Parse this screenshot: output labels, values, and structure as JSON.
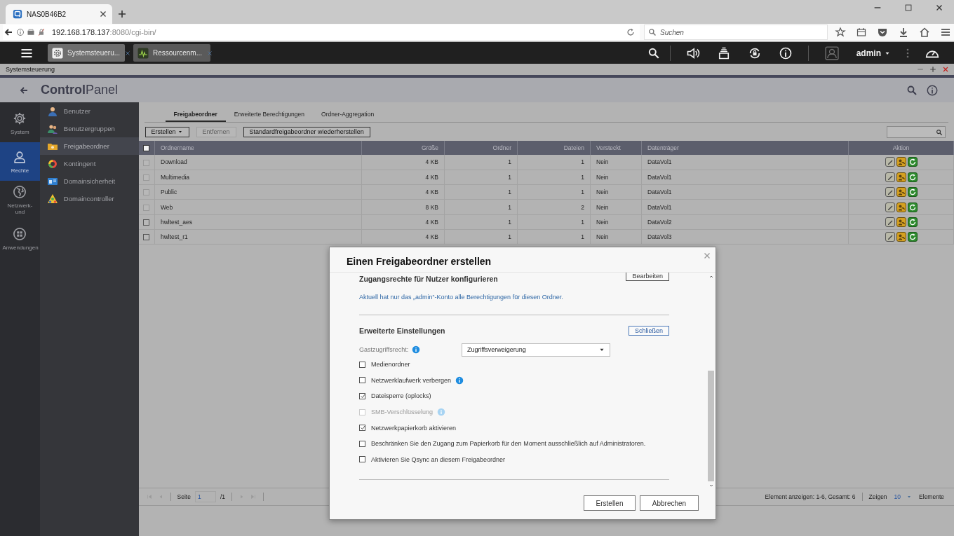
{
  "browser": {
    "tab_title": "NAS0B46B2",
    "url_host": "192.168.178.137",
    "url_rest": ":8080/cgi-bin/",
    "search_placeholder": "Suchen"
  },
  "app_bar": {
    "tabs": [
      {
        "label": "Systemsteueru...",
        "selected": true
      },
      {
        "label": "Ressourcenm...",
        "selected": false
      }
    ],
    "user": "admin"
  },
  "window": {
    "title": "Systemsteuerung"
  },
  "header": {
    "title": "**Control**Panel"
  },
  "nav": [
    {
      "label": "System",
      "selected": false
    },
    {
      "label": "Rechte",
      "selected": true
    },
    {
      "label": "Netzwerk- und",
      "selected": false
    },
    {
      "label": "Anwendungen",
      "selected": false
    }
  ],
  "sub_nav": [
    {
      "label": "Benutzer",
      "selected": false
    },
    {
      "label": "Benutzergruppen",
      "selected": false
    },
    {
      "label": "Freigabeordner",
      "selected": true
    },
    {
      "label": "Kontingent",
      "selected": false
    },
    {
      "label": "Domainsicherheit",
      "selected": false
    },
    {
      "label": "Domaincontroller",
      "selected": false
    }
  ],
  "tabs": [
    {
      "label": "Freigabeordner",
      "selected": true
    },
    {
      "label": "Erweiterte Berechtigungen",
      "selected": false
    },
    {
      "label": "Ordner-Aggregation",
      "selected": false
    }
  ],
  "toolbar": [
    {
      "label": "Erstellen",
      "disabled": false,
      "dropdown": true
    },
    {
      "label": "Entfernen",
      "disabled": true,
      "dropdown": false
    },
    {
      "label": "Standardfreigabeordner wiederherstellen",
      "disabled": false,
      "dropdown": false
    }
  ],
  "table": {
    "select_all_checked": false,
    "columns": [
      "Ordnername",
      "Größe",
      "Ordner",
      "Dateien",
      "Versteckt",
      "Datenträger",
      "Aktion"
    ],
    "rows": [
      {
        "cells": [
          "Download",
          "4 KB",
          "1",
          "1",
          "Nein",
          "DataVol1"
        ],
        "disabled": true,
        "checked": false
      },
      {
        "cells": [
          "Multimedia",
          "4 KB",
          "1",
          "1",
          "Nein",
          "DataVol1"
        ],
        "disabled": true,
        "checked": false
      },
      {
        "cells": [
          "Public",
          "4 KB",
          "1",
          "1",
          "Nein",
          "DataVol1"
        ],
        "disabled": true,
        "checked": false
      },
      {
        "cells": [
          "Web",
          "8 KB",
          "1",
          "2",
          "Nein",
          "DataVol1"
        ],
        "disabled": true,
        "checked": false
      },
      {
        "cells": [
          "hwltest_aes",
          "4 KB",
          "1",
          "1",
          "Nein",
          "DataVol2"
        ],
        "disabled": false,
        "checked": false
      },
      {
        "cells": [
          "hwltest_r1",
          "4 KB",
          "1",
          "1",
          "Nein",
          "DataVol3"
        ],
        "disabled": false,
        "checked": false
      }
    ]
  },
  "pager": {
    "page_label": "Seite",
    "page": "1",
    "total": "/1",
    "summary": "Element anzeigen: 1-6, Gesamt: 6",
    "show_label": "Zeigen",
    "per_page": "10",
    "unit": "Elemente"
  },
  "dialog": {
    "title": "Einen Freigabeordner erstellen",
    "edit_button": "Bearbeiten",
    "access_title": "Zugangsrechte für Nutzer konfigurieren",
    "access_note": "Aktuell hat nur das „admin“-Konto alle Berechtigungen für diesen Ordner.",
    "advanced_title": "Erweiterte Einstellungen",
    "close_button": "Schließen",
    "guest_label": "Gastzugriffsrecht:",
    "guest_value": "Zugriffsverweigerung",
    "options": [
      {
        "label": "Medienordner",
        "checked": false,
        "disabled": false,
        "info": false
      },
      {
        "label": "Netzwerklaufwerk verbergen",
        "checked": false,
        "disabled": false,
        "info": true
      },
      {
        "label": "Dateisperre (oplocks)",
        "checked": true,
        "disabled": false,
        "info": false
      },
      {
        "label": "SMB-Verschlüsselung",
        "checked": false,
        "disabled": true,
        "info": true
      },
      {
        "label": "Netzwerkpapierkorb aktivieren",
        "checked": true,
        "disabled": false,
        "info": false
      },
      {
        "label": "Beschränken Sie den Zugang zum Papierkorb für den Moment ausschließlich auf Administratoren.",
        "checked": false,
        "disabled": false,
        "info": false
      },
      {
        "label": "Aktivieren Sie Qsync an diesem Freigabeordner",
        "checked": false,
        "disabled": false,
        "info": false
      }
    ],
    "buttons": [
      "Erstellen",
      "Abbrechen"
    ]
  }
}
